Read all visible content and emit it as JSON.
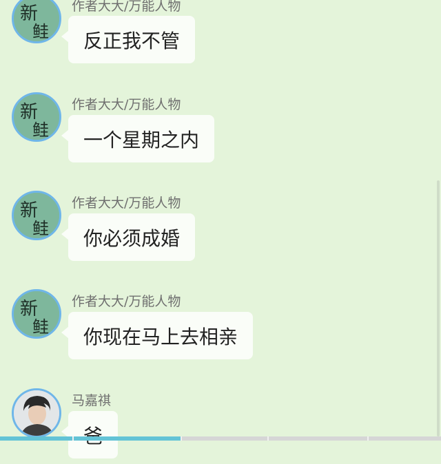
{
  "messages": [
    {
      "sender": "作者大大/万能人物",
      "text": "反正我不管",
      "avatar": "xin-bao-avatar"
    },
    {
      "sender": "作者大大/万能人物",
      "text": "一个星期之内",
      "avatar": "xin-bao-avatar"
    },
    {
      "sender": "作者大大/万能人物",
      "text": "你必须成婚",
      "avatar": "xin-bao-avatar"
    },
    {
      "sender": "作者大大/万能人物",
      "text": "你现在马上去相亲",
      "avatar": "xin-bao-avatar"
    },
    {
      "sender": "马嘉祺",
      "text": "爸",
      "avatar": "person-photo-avatar"
    }
  ],
  "avatar_text": {
    "line1": "新",
    "line2": "鲑"
  },
  "progress": {
    "fraction": 0.41
  },
  "colors": {
    "background": "#e4f4da",
    "bubble": "#fafdf8",
    "avatar_border": "#6fb6e9",
    "avatar_fill": "#7eb79c",
    "progress_fill": "#63c3d6"
  }
}
